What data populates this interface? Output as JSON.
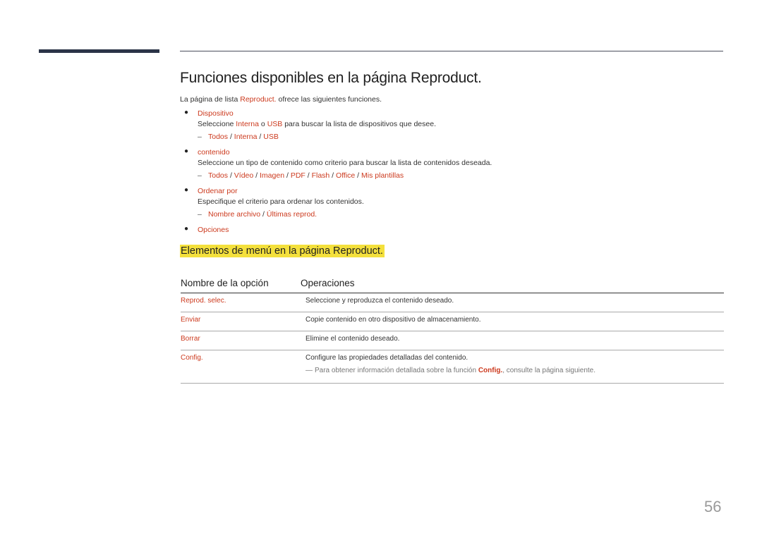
{
  "page": {
    "title": "Funciones disponibles en la página Reproduct.",
    "intro": {
      "before": "La página de lista ",
      "highlight": "Reproduct.",
      "after": " ofrece las siguientes funciones."
    },
    "bullets": [
      {
        "title": "Dispositivo",
        "desc_parts": [
          {
            "text": "Seleccione ",
            "red": false
          },
          {
            "text": "Interna",
            "red": true
          },
          {
            "text": " o ",
            "red": false
          },
          {
            "text": "USB",
            "red": true
          },
          {
            "text": " para buscar la lista de dispositivos que desee.",
            "red": false
          }
        ],
        "options": [
          "Todos",
          "Interna",
          "USB"
        ]
      },
      {
        "title": "contenido",
        "desc": "Seleccione un tipo de contenido como criterio para buscar la lista de contenidos deseada.",
        "options": [
          "Todos",
          "Vídeo",
          "Imagen",
          "PDF",
          "Flash",
          "Office",
          "Mis plantillas"
        ]
      },
      {
        "title": "Ordenar por",
        "desc": "Especifique el criterio para ordenar los contenidos.",
        "options": [
          "Nombre archivo",
          "Últimas reprod."
        ]
      },
      {
        "title": "Opciones"
      }
    ],
    "section2_title": "Elementos de menú en la página Reproduct.",
    "table": {
      "headers": [
        "Nombre de la opción",
        "Operaciones"
      ],
      "rows": [
        {
          "name": "Reprod. selec.",
          "op": "Seleccione y reproduzca el contenido deseado."
        },
        {
          "name": "Enviar",
          "op": "Copie contenido en otro dispositivo de almacenamiento."
        },
        {
          "name": "Borrar",
          "op": "Elimine el contenido deseado."
        },
        {
          "name": "Config.",
          "op": "Configure las propiedades detalladas del contenido.",
          "note": {
            "mark": "―",
            "before": "Para obtener información detallada sobre la función ",
            "highlight": "Config.",
            "after": ", consulte la página siguiente."
          }
        }
      ]
    },
    "page_number": "56",
    "separator": " / "
  }
}
